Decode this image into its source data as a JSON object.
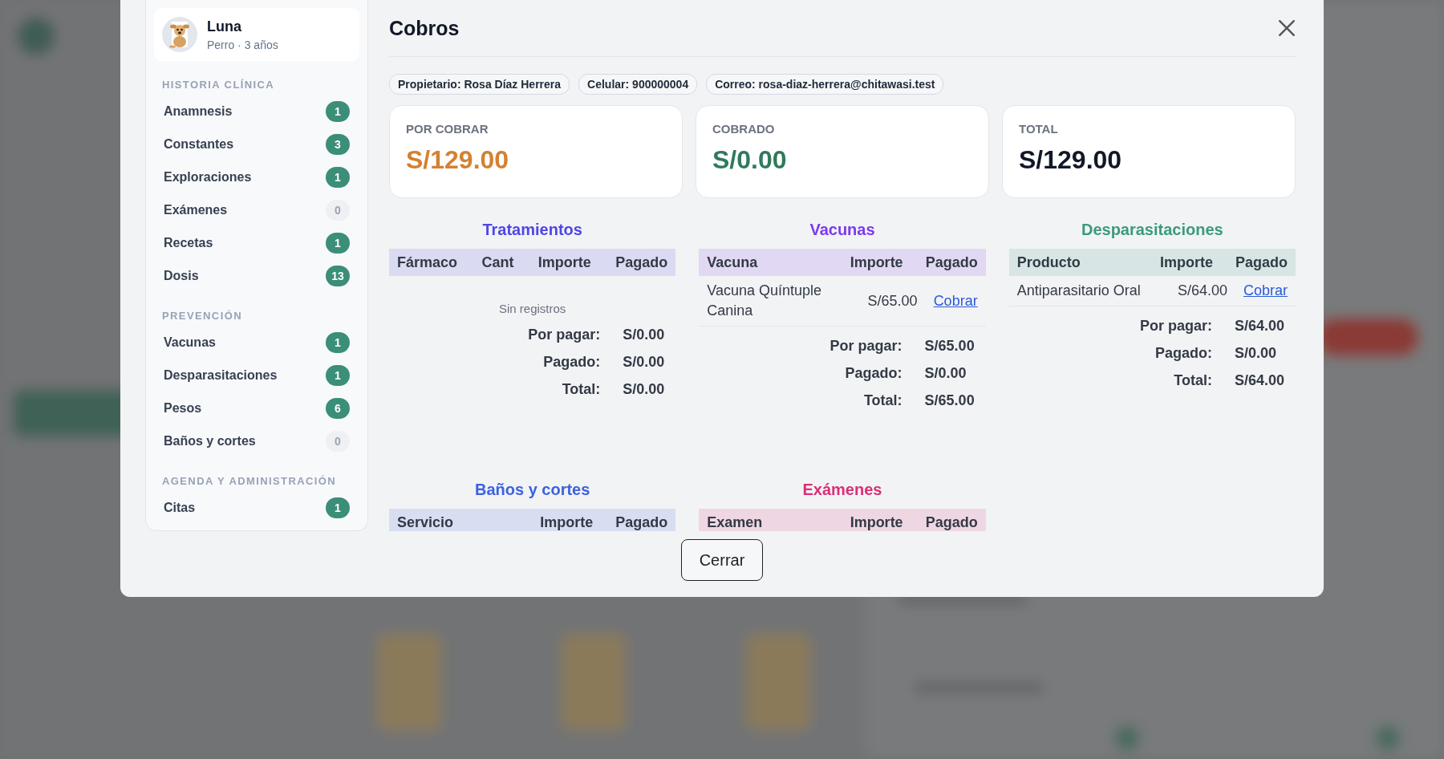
{
  "patient": {
    "name": "Luna",
    "details": "Perro · 3 años"
  },
  "sidebar": {
    "groups": [
      {
        "title": "HISTORIA CLÍNICA",
        "items": [
          {
            "label": "Anamnesis",
            "count": "1",
            "highlighted": true
          },
          {
            "label": "Constantes",
            "count": "3",
            "highlighted": true
          },
          {
            "label": "Exploraciones",
            "count": "1",
            "highlighted": true
          },
          {
            "label": "Exámenes",
            "count": "0",
            "highlighted": false
          },
          {
            "label": "Recetas",
            "count": "1",
            "highlighted": true
          },
          {
            "label": "Dosis",
            "count": "13",
            "highlighted": true
          }
        ]
      },
      {
        "title": "PREVENCIÓN",
        "items": [
          {
            "label": "Vacunas",
            "count": "1",
            "highlighted": true
          },
          {
            "label": "Desparasitaciones",
            "count": "1",
            "highlighted": true
          },
          {
            "label": "Pesos",
            "count": "6",
            "highlighted": true
          },
          {
            "label": "Baños y cortes",
            "count": "0",
            "highlighted": false
          }
        ]
      },
      {
        "title": "AGENDA Y ADMINISTRACIÓN",
        "items": [
          {
            "label": "Citas",
            "count": "1",
            "highlighted": true
          }
        ]
      }
    ]
  },
  "dialog": {
    "title": "Cobros",
    "chips": [
      "Propietario: Rosa Díaz Herrera",
      "Celular: 900000004",
      "Correo: rosa-diaz-herrera@chitawasi.test"
    ],
    "summary": [
      {
        "label": "POR COBRAR",
        "value": "S/129.00",
        "color": "#d4812f"
      },
      {
        "label": "COBRADO",
        "value": "S/0.00",
        "color": "#2f7a5c"
      },
      {
        "label": "TOTAL",
        "value": "S/129.00",
        "color": "#111827"
      }
    ],
    "sections": [
      {
        "title": "Tratamientos",
        "color": "#4f46e5",
        "columns": [
          "Fármaco",
          "Cant",
          "Importe",
          "Pagado"
        ],
        "empty_text": "Sin registros",
        "totals": [
          {
            "label": "Por pagar:",
            "value": "S/0.00"
          },
          {
            "label": "Pagado:",
            "value": "S/0.00"
          },
          {
            "label": "Total:",
            "value": "S/0.00"
          }
        ]
      },
      {
        "title": "Vacunas",
        "color": "#7c3aed",
        "columns": [
          "Vacuna",
          "Importe",
          "Pagado"
        ],
        "rows": [
          [
            {
              "kind": "text",
              "text": "Vacuna Quíntuple Canina"
            },
            {
              "kind": "text",
              "text": "S/65.00"
            },
            {
              "kind": "link",
              "text": "Cobrar"
            }
          ]
        ],
        "totals": [
          {
            "label": "Por pagar:",
            "value": "S/65.00"
          },
          {
            "label": "Pagado:",
            "value": "S/0.00"
          },
          {
            "label": "Total:",
            "value": "S/65.00"
          }
        ]
      },
      {
        "title": "Desparasitaciones",
        "color": "#3a9a7e",
        "columns": [
          "Producto",
          "Importe",
          "Pagado"
        ],
        "rows": [
          [
            {
              "kind": "text",
              "text": "Antiparasitario Oral"
            },
            {
              "kind": "text",
              "text": "S/64.00"
            },
            {
              "kind": "link",
              "text": "Cobrar"
            }
          ]
        ],
        "totals": [
          {
            "label": "Por pagar:",
            "value": "S/64.00"
          },
          {
            "label": "Pagado:",
            "value": "S/0.00"
          },
          {
            "label": "Total:",
            "value": "S/64.00"
          }
        ]
      },
      {
        "title": "Baños y cortes",
        "color": "#3b62e0",
        "columns": [
          "Servicio",
          "Importe",
          "Pagado"
        ]
      },
      {
        "title": "Exámenes",
        "color": "#db2f77",
        "columns": [
          "Examen",
          "Importe",
          "Pagado"
        ]
      }
    ],
    "close_button": "Cerrar"
  }
}
